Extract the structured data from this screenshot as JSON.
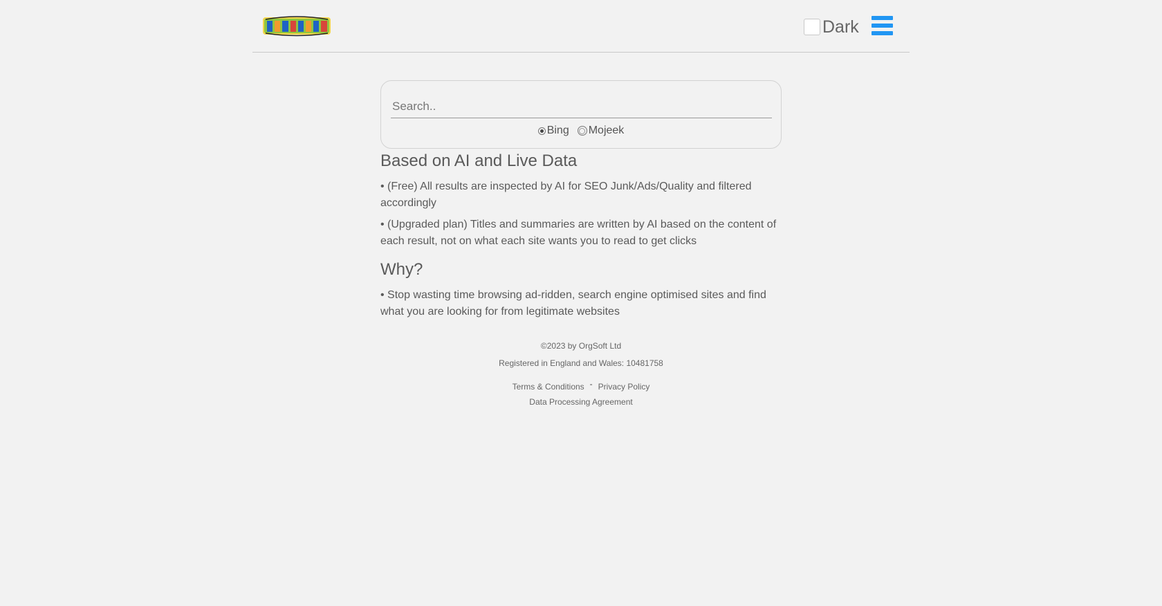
{
  "header": {
    "logo_alt": "Lettered logo",
    "dark_label": "Dark",
    "menu_icon": "hamburger-menu-icon"
  },
  "search": {
    "placeholder": "Search..",
    "value": "",
    "engines": [
      {
        "label": "Bing",
        "selected": true
      },
      {
        "label": "Mojeek",
        "selected": false
      }
    ]
  },
  "content": {
    "heading_ai": "Based on AI and Live Data",
    "bullet_free": "• (Free) All results are inspected by AI for SEO Junk/Ads/Quality and filtered accordingly",
    "bullet_upgraded": "• (Upgraded plan) Titles and summaries are written by AI based on the content of each result, not on what each site wants you to read to get clicks",
    "heading_why": "Why?",
    "bullet_why": "• Stop wasting time browsing ad-ridden, search engine optimised sites and find what you are looking for from legitimate websites"
  },
  "footer": {
    "copyright": "©2023 by OrgSoft Ltd",
    "registration": "Registered in England and Wales: 10481758",
    "terms": "Terms & Conditions",
    "separator": "-",
    "privacy": "Privacy Policy",
    "dpa": "Data Processing Agreement"
  },
  "colors": {
    "background": "#f2f2f2",
    "accent": "#2196f3",
    "text": "#5a5a5a"
  }
}
